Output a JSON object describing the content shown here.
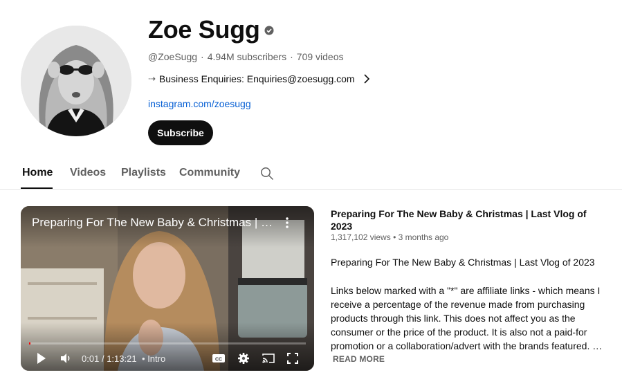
{
  "channel": {
    "name": "Zoe Sugg",
    "handle": "@ZoeSugg",
    "subscribers": "4.94M subscribers",
    "videos": "709 videos",
    "description_arrow": "⇢",
    "description": "Business Enquiries: Enquiries@zoesugg.com",
    "link": "instagram.com/zoesugg",
    "subscribe_label": "Subscribe",
    "separator": "·"
  },
  "tabs": [
    {
      "label": "Home",
      "active": true
    },
    {
      "label": "Videos",
      "active": false
    },
    {
      "label": "Playlists",
      "active": false
    },
    {
      "label": "Community",
      "active": false
    }
  ],
  "player": {
    "title": "Preparing For The New Baby & Christmas | Last Vlog of 2023",
    "current_time": "0:01",
    "duration": "1:13:21",
    "time_separator": "/",
    "chapter_bullet": "•",
    "chapter": "Intro",
    "progress_fraction": 0.0002
  },
  "video": {
    "title": "Preparing For The New Baby & Christmas | Last Vlog of 2023",
    "views": "1,317,102 views",
    "meta_bullet": "•",
    "age": "3 months ago",
    "description_title": "Preparing For The New Baby & Christmas | Last Vlog of 2023",
    "description": "Links below marked with a \"*\" are affiliate links - which means I receive a percentage of the revenue made from purchasing products through this link. This does not affect you as the consumer or the price of the product. It is also not a paid-for promotion or a collaboration/advert with the brands featured. …",
    "read_more": "READ MORE"
  },
  "colors": {
    "link": "#065fd4",
    "subscribe_bg": "#0f0f0f",
    "progress": "#ff0000",
    "secondary_text": "#606060"
  },
  "icons": [
    "verified-badge-icon",
    "chevron-right-icon",
    "search-icon",
    "play-icon",
    "volume-icon",
    "captions-icon",
    "settings-icon",
    "cast-icon",
    "fullscreen-icon",
    "more-vert-icon"
  ]
}
